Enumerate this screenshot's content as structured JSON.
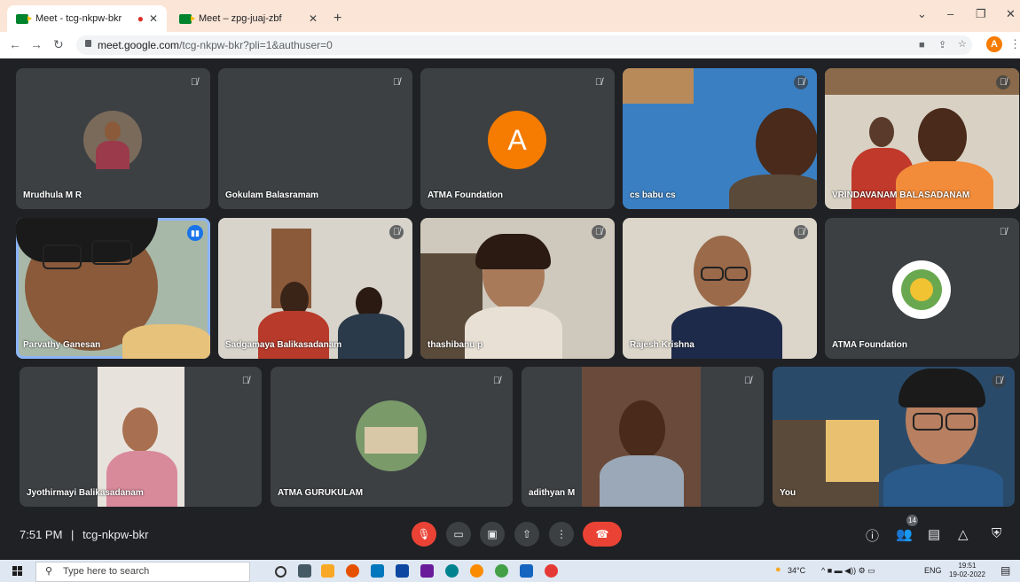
{
  "browser": {
    "tabs": [
      {
        "title": "Meet - tcg-nkpw-bkr",
        "active": true,
        "recording": true
      },
      {
        "title": "Meet – zpg-juaj-zbf",
        "active": false
      }
    ],
    "url_host": "meet.google.com",
    "url_path": "/tcg-nkpw-bkr?pli=1&authuser=0",
    "profile_initial": "A"
  },
  "participants": [
    {
      "name": "Mrudhula M R"
    },
    {
      "name": "Gokulam Balasramam"
    },
    {
      "name": "ATMA Foundation",
      "avatar_letter": "A"
    },
    {
      "name": "cs babu cs"
    },
    {
      "name": "VRINDAVANAM BALASADANAM"
    },
    {
      "name": "Parvathy Ganesan",
      "speaking": true
    },
    {
      "name": "Sadgamaya Balikasadanam"
    },
    {
      "name": "thashibanu p"
    },
    {
      "name": "Rajesh Krishna"
    },
    {
      "name": "ATMA Foundation"
    },
    {
      "name": "Jyothirmayi Balikasadanam"
    },
    {
      "name": "ATMA GURUKULAM"
    },
    {
      "name": "adithyan M"
    },
    {
      "name": "You"
    }
  ],
  "meeting": {
    "time": "7:51 PM",
    "separator": "|",
    "code": "tcg-nkpw-bkr",
    "participant_count": "14"
  },
  "taskbar": {
    "search_placeholder": "Type here to search",
    "weather": "34°C",
    "language": "ENG",
    "clock_time": "19:51",
    "clock_date": "19-02-2022"
  },
  "colors": {
    "tab_strip": "#fbe5d6",
    "meet_bg": "#202124",
    "tile_bg": "#3c4043",
    "accent_orange": "#f57c00",
    "hangup_red": "#ea4335",
    "speaking_blue": "#8ab4f8"
  },
  "icons": [
    "search-icon",
    "lock-icon",
    "mic-off-icon",
    "camera-icon",
    "captions-icon",
    "present-icon",
    "more-icon",
    "hangup-icon",
    "info-icon",
    "people-icon",
    "chat-icon",
    "activities-icon",
    "host-controls-icon"
  ]
}
